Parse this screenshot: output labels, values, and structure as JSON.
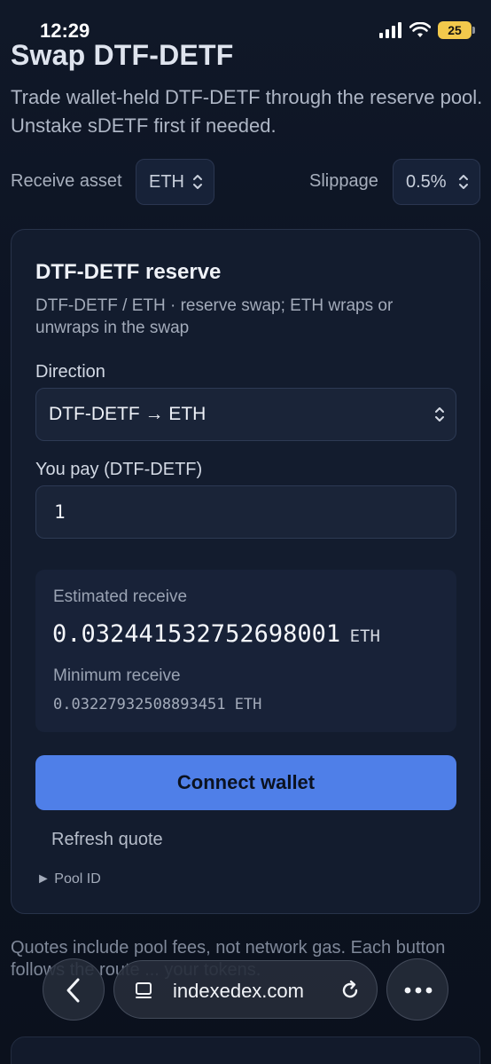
{
  "status": {
    "time": "12:29",
    "battery": "25"
  },
  "page": {
    "title": "Swap DTF-DETF",
    "description": "Trade wallet-held DTF-DETF through the reserve pool. Unstake sDETF first if needed."
  },
  "controls": {
    "receive_label": "Receive asset",
    "receive_value": "ETH",
    "slippage_label": "Slippage",
    "slippage_value": "0.5%"
  },
  "card": {
    "title": "DTF-DETF reserve",
    "subtitle": "DTF-DETF / ETH · reserve swap; ETH wraps or unwraps in the swap",
    "direction_label": "Direction",
    "direction_value": "DTF-DETF → ETH",
    "pay_label": "You pay (DTF-DETF)",
    "pay_value": "1",
    "estimated_label": "Estimated receive",
    "estimated_value": "0.032441532752698001",
    "estimated_unit": "ETH",
    "minimum_label": "Minimum receive",
    "minimum_value": "0.03227932508893451 ETH",
    "connect_label": "Connect wallet",
    "refresh_label": "Refresh quote",
    "pool_id_label": "► Pool ID"
  },
  "footer": {
    "note": "Quotes include pool fees, not network gas. Each button follows the route ... your tokens."
  },
  "browser": {
    "url": "indexedex.com"
  }
}
